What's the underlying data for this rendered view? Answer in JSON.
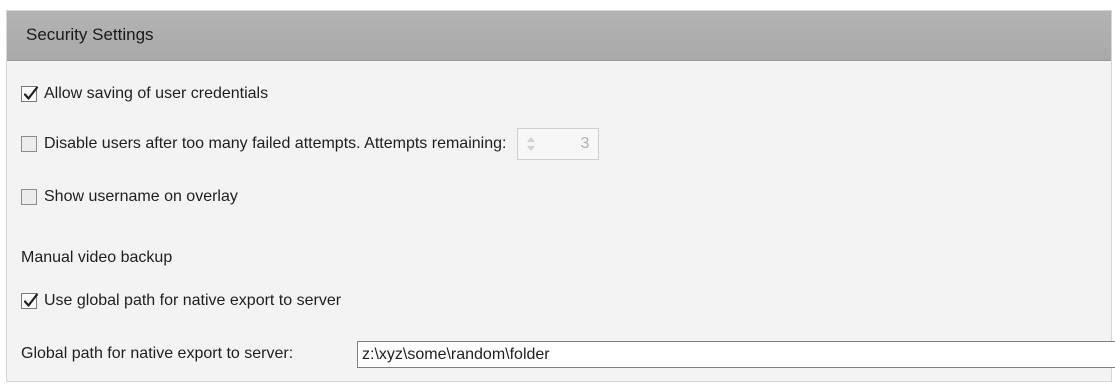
{
  "header": {
    "title": "Security Settings"
  },
  "options": {
    "allow_saving": {
      "label": "Allow saving of user credentials",
      "checked": true
    },
    "disable_users": {
      "label": "Disable users after too many failed attempts. Attempts remaining:",
      "checked": false,
      "attempts_value": "3",
      "attempts_disabled": true
    },
    "show_username": {
      "label": "Show username on overlay",
      "checked": false
    }
  },
  "manual_backup": {
    "section_label": "Manual video backup",
    "use_global_path": {
      "label": "Use global path for native export to server",
      "checked": true
    },
    "global_path": {
      "label": "Global path for native export to server:",
      "value": "z:\\xyz\\some\\random\\folder"
    }
  },
  "colors": {
    "header_bg": "#afafaf",
    "panel_bg": "#f3f3f3",
    "text": "#1e1e1e"
  },
  "icons": {
    "checkmark": "check-icon",
    "spinner_arrows": "spin-arrows-icon"
  }
}
